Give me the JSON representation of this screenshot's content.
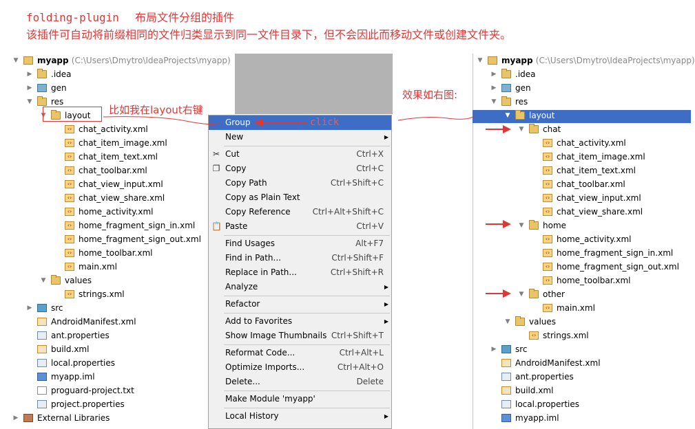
{
  "header": {
    "plugin_name": "folding-plugin",
    "plugin_desc": "布局文件分组的插件",
    "line2": "该插件可自动将前缀相同的文件归类显示到同一文件目录下，但不会因此而移动文件或创建文件夹。"
  },
  "annotations": {
    "right_click_note": "比如我在layout右键",
    "click_label": "click",
    "effect_label": "效果如右图:"
  },
  "left_tree": {
    "project_name": "myapp",
    "project_path": "(C:\\Users\\Dmytro\\IdeaProjects\\myapp)",
    "rows": [
      {
        "label": "myapp",
        "indent": 0,
        "toggle": "▼",
        "icon": "module-icon",
        "cls": "modic"
      },
      {
        "label": ".idea",
        "indent": 1,
        "toggle": "▶",
        "icon": "folder-icon",
        "cls": "folder"
      },
      {
        "label": "gen",
        "indent": 1,
        "toggle": "▶",
        "icon": "gen-folder-icon",
        "cls": "genic"
      },
      {
        "label": "res",
        "indent": 1,
        "toggle": "▼",
        "icon": "res-folder-icon",
        "cls": "folder"
      },
      {
        "label": "layout",
        "indent": 2,
        "toggle": "▼",
        "icon": "folder-icon",
        "cls": "folder"
      },
      {
        "label": "chat_activity.xml",
        "indent": 3,
        "toggle": "",
        "icon": "xml-file-icon",
        "cls": "xmlic"
      },
      {
        "label": "chat_item_image.xml",
        "indent": 3,
        "toggle": "",
        "icon": "xml-file-icon",
        "cls": "xmlic"
      },
      {
        "label": "chat_item_text.xml",
        "indent": 3,
        "toggle": "",
        "icon": "xml-file-icon",
        "cls": "xmlic"
      },
      {
        "label": "chat_toolbar.xml",
        "indent": 3,
        "toggle": "",
        "icon": "xml-file-icon",
        "cls": "xmlic"
      },
      {
        "label": "chat_view_input.xml",
        "indent": 3,
        "toggle": "",
        "icon": "xml-file-icon",
        "cls": "xmlic"
      },
      {
        "label": "chat_view_share.xml",
        "indent": 3,
        "toggle": "",
        "icon": "xml-file-icon",
        "cls": "xmlic"
      },
      {
        "label": "home_activity.xml",
        "indent": 3,
        "toggle": "",
        "icon": "xml-file-icon",
        "cls": "xmlic"
      },
      {
        "label": "home_fragment_sign_in.xml",
        "indent": 3,
        "toggle": "",
        "icon": "xml-file-icon",
        "cls": "xmlic"
      },
      {
        "label": "home_fragment_sign_out.xml",
        "indent": 3,
        "toggle": "",
        "icon": "xml-file-icon",
        "cls": "xmlic"
      },
      {
        "label": "home_toolbar.xml",
        "indent": 3,
        "toggle": "",
        "icon": "xml-file-icon",
        "cls": "xmlic"
      },
      {
        "label": "main.xml",
        "indent": 3,
        "toggle": "",
        "icon": "xml-file-icon",
        "cls": "xmlic"
      },
      {
        "label": "values",
        "indent": 2,
        "toggle": "▼",
        "icon": "folder-icon",
        "cls": "folder"
      },
      {
        "label": "strings.xml",
        "indent": 3,
        "toggle": "",
        "icon": "xml-file-icon",
        "cls": "xmlic"
      },
      {
        "label": "src",
        "indent": 1,
        "toggle": "▶",
        "icon": "src-folder-icon",
        "cls": "srcic"
      },
      {
        "label": "AndroidManifest.xml",
        "indent": 1,
        "toggle": "",
        "icon": "manifest-file-icon",
        "cls": "xmlfile"
      },
      {
        "label": "ant.properties",
        "indent": 1,
        "toggle": "",
        "icon": "properties-file-icon",
        "cls": "propic"
      },
      {
        "label": "build.xml",
        "indent": 1,
        "toggle": "",
        "icon": "xml-file-icon",
        "cls": "xmlfile"
      },
      {
        "label": "local.properties",
        "indent": 1,
        "toggle": "",
        "icon": "properties-file-icon",
        "cls": "propic"
      },
      {
        "label": "myapp.iml",
        "indent": 1,
        "toggle": "",
        "icon": "iml-file-icon",
        "cls": "imlic"
      },
      {
        "label": "proguard-project.txt",
        "indent": 1,
        "toggle": "",
        "icon": "text-file-icon",
        "cls": "fileic"
      },
      {
        "label": "project.properties",
        "indent": 1,
        "toggle": "",
        "icon": "properties-file-icon",
        "cls": "propic"
      },
      {
        "label": "External Libraries",
        "indent": 0,
        "toggle": "▶",
        "icon": "libraries-icon",
        "cls": "libic"
      }
    ]
  },
  "context_menu": {
    "items": [
      {
        "label": "Group",
        "shortcut": "",
        "submenu": false,
        "selected": true,
        "icon": ""
      },
      {
        "label": "New",
        "shortcut": "",
        "submenu": true,
        "icon": ""
      },
      {
        "sep": true
      },
      {
        "label": "Cut",
        "shortcut": "Ctrl+X",
        "submenu": false,
        "icon": "✂"
      },
      {
        "label": "Copy",
        "shortcut": "Ctrl+C",
        "submenu": false,
        "icon": "❐"
      },
      {
        "label": "Copy Path",
        "shortcut": "Ctrl+Shift+C",
        "submenu": false,
        "icon": ""
      },
      {
        "label": "Copy as Plain Text",
        "shortcut": "",
        "submenu": false,
        "icon": ""
      },
      {
        "label": "Copy Reference",
        "shortcut": "Ctrl+Alt+Shift+C",
        "submenu": false,
        "icon": ""
      },
      {
        "label": "Paste",
        "shortcut": "Ctrl+V",
        "submenu": false,
        "icon": "📋"
      },
      {
        "sep": true
      },
      {
        "label": "Find Usages",
        "shortcut": "Alt+F7",
        "submenu": false,
        "icon": ""
      },
      {
        "label": "Find in Path...",
        "shortcut": "Ctrl+Shift+F",
        "submenu": false,
        "icon": ""
      },
      {
        "label": "Replace in Path...",
        "shortcut": "Ctrl+Shift+R",
        "submenu": false,
        "icon": ""
      },
      {
        "label": "Analyze",
        "shortcut": "",
        "submenu": true,
        "icon": ""
      },
      {
        "sep": true
      },
      {
        "label": "Refactor",
        "shortcut": "",
        "submenu": true,
        "icon": ""
      },
      {
        "sep": true
      },
      {
        "label": "Add to Favorites",
        "shortcut": "",
        "submenu": true,
        "icon": ""
      },
      {
        "label": "Show Image Thumbnails",
        "shortcut": "Ctrl+Shift+T",
        "submenu": false,
        "icon": ""
      },
      {
        "sep": true
      },
      {
        "label": "Reformat Code...",
        "shortcut": "Ctrl+Alt+L",
        "submenu": false,
        "icon": ""
      },
      {
        "label": "Optimize Imports...",
        "shortcut": "Ctrl+Alt+O",
        "submenu": false,
        "icon": ""
      },
      {
        "label": "Delete...",
        "shortcut": "Delete",
        "submenu": false,
        "icon": ""
      },
      {
        "sep": true
      },
      {
        "label": "Make Module 'myapp'",
        "shortcut": "",
        "submenu": false,
        "icon": ""
      },
      {
        "sep": true
      },
      {
        "label": "Local History",
        "shortcut": "",
        "submenu": true,
        "icon": ""
      }
    ]
  },
  "right_tree": {
    "project_path": "(C:\\Users\\Dmytro\\IdeaProjects\\myapp)",
    "rows": [
      {
        "label": "myapp",
        "indent": 0,
        "toggle": "▼",
        "icon": "module-icon",
        "cls": "modic"
      },
      {
        "label": ".idea",
        "indent": 1,
        "toggle": "▶",
        "icon": "folder-icon",
        "cls": "folder"
      },
      {
        "label": "gen",
        "indent": 1,
        "toggle": "▶",
        "icon": "gen-folder-icon",
        "cls": "genic"
      },
      {
        "label": "res",
        "indent": 1,
        "toggle": "▼",
        "icon": "res-folder-icon",
        "cls": "folder"
      },
      {
        "label": "layout",
        "indent": 2,
        "toggle": "▼",
        "icon": "folder-icon",
        "cls": "folder",
        "selected": true
      },
      {
        "label": "chat",
        "indent": 3,
        "toggle": "▼",
        "icon": "folder-icon",
        "cls": "folder"
      },
      {
        "label": "chat_activity.xml",
        "indent": 4,
        "toggle": "",
        "icon": "xml-file-icon",
        "cls": "xmlic"
      },
      {
        "label": "chat_item_image.xml",
        "indent": 4,
        "toggle": "",
        "icon": "xml-file-icon",
        "cls": "xmlic"
      },
      {
        "label": "chat_item_text.xml",
        "indent": 4,
        "toggle": "",
        "icon": "xml-file-icon",
        "cls": "xmlic"
      },
      {
        "label": "chat_toolbar.xml",
        "indent": 4,
        "toggle": "",
        "icon": "xml-file-icon",
        "cls": "xmlic"
      },
      {
        "label": "chat_view_input.xml",
        "indent": 4,
        "toggle": "",
        "icon": "xml-file-icon",
        "cls": "xmlic"
      },
      {
        "label": "chat_view_share.xml",
        "indent": 4,
        "toggle": "",
        "icon": "xml-file-icon",
        "cls": "xmlic"
      },
      {
        "label": "home",
        "indent": 3,
        "toggle": "▼",
        "icon": "folder-icon",
        "cls": "folder"
      },
      {
        "label": "home_activity.xml",
        "indent": 4,
        "toggle": "",
        "icon": "xml-file-icon",
        "cls": "xmlic"
      },
      {
        "label": "home_fragment_sign_in.xml",
        "indent": 4,
        "toggle": "",
        "icon": "xml-file-icon",
        "cls": "xmlic"
      },
      {
        "label": "home_fragment_sign_out.xml",
        "indent": 4,
        "toggle": "",
        "icon": "xml-file-icon",
        "cls": "xmlic"
      },
      {
        "label": "home_toolbar.xml",
        "indent": 4,
        "toggle": "",
        "icon": "xml-file-icon",
        "cls": "xmlic"
      },
      {
        "label": "other",
        "indent": 3,
        "toggle": "▼",
        "icon": "folder-icon",
        "cls": "folder"
      },
      {
        "label": "main.xml",
        "indent": 4,
        "toggle": "",
        "icon": "xml-file-icon",
        "cls": "xmlic"
      },
      {
        "label": "values",
        "indent": 2,
        "toggle": "▼",
        "icon": "folder-icon",
        "cls": "folder"
      },
      {
        "label": "strings.xml",
        "indent": 3,
        "toggle": "",
        "icon": "xml-file-icon",
        "cls": "xmlic"
      },
      {
        "label": "src",
        "indent": 1,
        "toggle": "▶",
        "icon": "src-folder-icon",
        "cls": "srcic"
      },
      {
        "label": "AndroidManifest.xml",
        "indent": 1,
        "toggle": "",
        "icon": "manifest-file-icon",
        "cls": "xmlfile"
      },
      {
        "label": "ant.properties",
        "indent": 1,
        "toggle": "",
        "icon": "properties-file-icon",
        "cls": "propic"
      },
      {
        "label": "build.xml",
        "indent": 1,
        "toggle": "",
        "icon": "xml-file-icon",
        "cls": "xmlfile"
      },
      {
        "label": "local.properties",
        "indent": 1,
        "toggle": "",
        "icon": "properties-file-icon",
        "cls": "propic"
      },
      {
        "label": "myapp.iml",
        "indent": 1,
        "toggle": "",
        "icon": "iml-file-icon",
        "cls": "imlic"
      }
    ]
  },
  "colors": {
    "annotation_red": "#d83a3a",
    "selection_blue": "#3d6dc4"
  }
}
